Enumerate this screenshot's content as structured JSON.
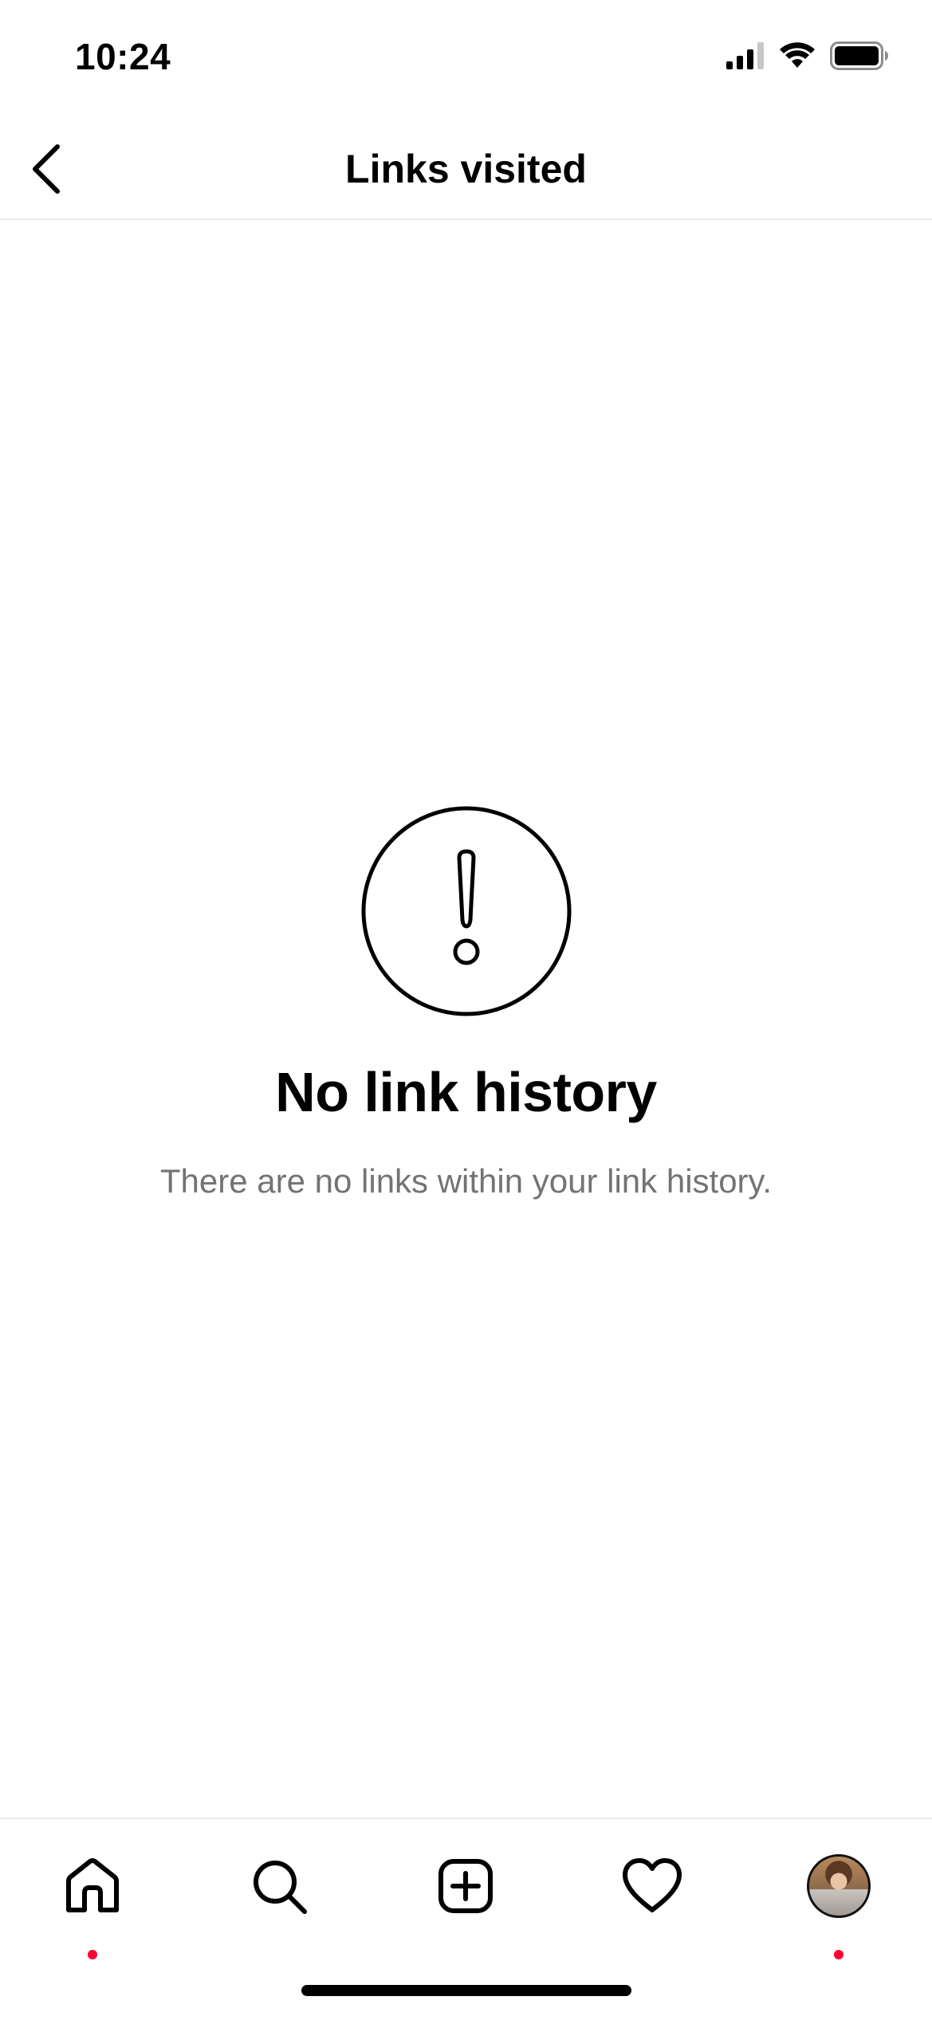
{
  "status_bar": {
    "time": "10:24",
    "icons": [
      "cellular-signal-icon",
      "wifi-icon",
      "battery-icon"
    ]
  },
  "header": {
    "title": "Links visited",
    "back_icon": "chevron-left-icon"
  },
  "empty_state": {
    "icon": "exclamation-circle-icon",
    "title": "No link history",
    "description": "There are no links within your link history."
  },
  "tab_bar": {
    "tabs": [
      {
        "name": "home",
        "icon": "home-icon",
        "has_dot": true
      },
      {
        "name": "search",
        "icon": "search-icon",
        "has_dot": false
      },
      {
        "name": "create",
        "icon": "plus-square-icon",
        "has_dot": false
      },
      {
        "name": "activity",
        "icon": "heart-icon",
        "has_dot": false
      },
      {
        "name": "profile",
        "icon": "avatar",
        "has_dot": true
      }
    ]
  },
  "colors": {
    "notification_dot": "#ff0033",
    "secondary_text": "#737373",
    "divider": "#ececec"
  }
}
